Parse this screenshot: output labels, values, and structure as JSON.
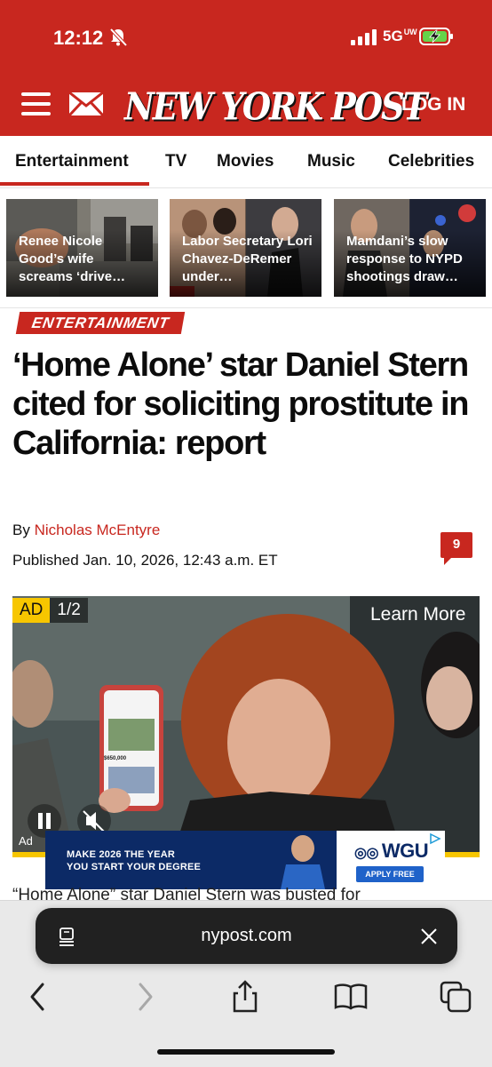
{
  "status_bar": {
    "time": "12:12",
    "network": "5G",
    "network_sub": "UW"
  },
  "header": {
    "logo": "NEW YORK POST",
    "login": "LOG IN"
  },
  "nav": {
    "items": [
      "Entertainment",
      "TV",
      "Movies",
      "Music",
      "Celebrities"
    ]
  },
  "teasers": [
    {
      "title": "Renee Nicole Good’s wife screams ‘drive…"
    },
    {
      "title": "Labor Secretary Lori Chavez-DeRemer under…"
    },
    {
      "title": "Mamdani’s slow response to NYPD shootings draw…"
    }
  ],
  "article": {
    "section": "ENTERTAINMENT",
    "headline": "‘Home Alone’ star Daniel Stern cited for soliciting prostitute in California: report",
    "by_prefix": "By",
    "author": "Nicholas McEntyre",
    "published": "Published Jan. 10, 2026, 12:43 a.m. ET",
    "comment_count": "9",
    "body_peek": "“Home Alone” star Daniel Stern was busted for"
  },
  "video_ad": {
    "ad_label": "AD",
    "counter": "1/2",
    "learn_more": "Learn More",
    "ad_small": "Ad",
    "phone_price": "$650,000"
  },
  "banner_ad": {
    "line1": "MAKE 2026 THE YEAR",
    "line2": "YOU START YOUR DEGREE",
    "logo": "WGU",
    "cta": "APPLY FREE"
  },
  "browser": {
    "url": "nypost.com"
  },
  "colors": {
    "brand_red": "#c8271f",
    "ad_yellow": "#f7c600",
    "banner_navy": "#0c2a66"
  }
}
